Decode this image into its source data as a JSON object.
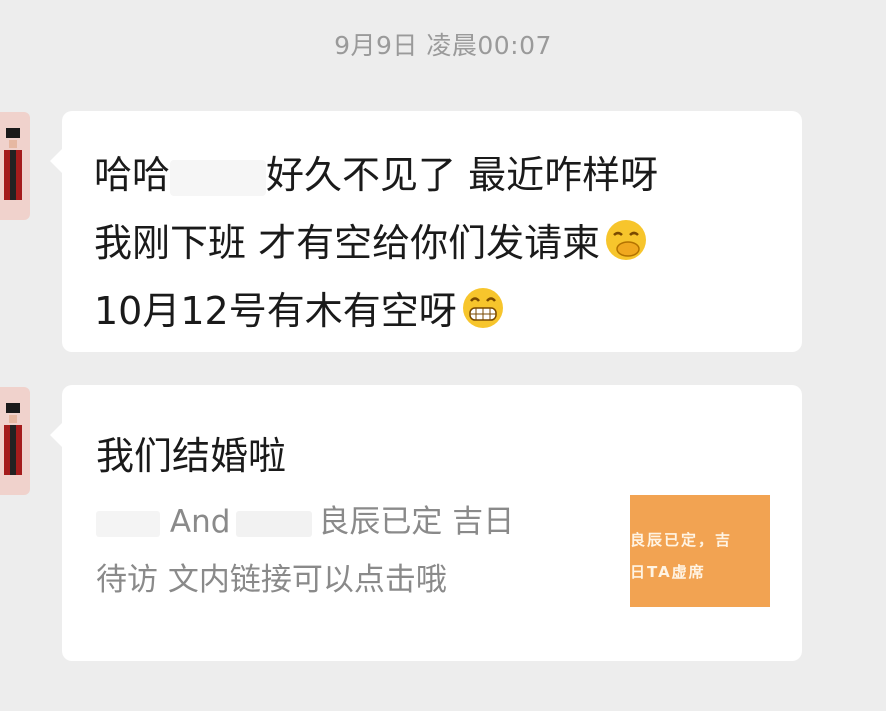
{
  "timestamp": "9月9日 凌晨00:07",
  "messages": [
    {
      "lines": [
        {
          "prefix": "哈哈",
          "suffix": "好久不见了 最近咋样呀"
        },
        {
          "text": "我刚下班  才有空给你们发请柬"
        },
        {
          "text": "10月12号有木有空呀"
        }
      ],
      "emojis": [
        "covering-mouth-laugh-emoji",
        "grin-emoji"
      ]
    },
    {
      "link_card": {
        "title": "我们结婚啦",
        "desc_and": "And",
        "desc_rest": "良辰已定 吉日",
        "desc_line2": "待访  文内链接可以点击哦",
        "thumbnail_line1": "良辰已定，吉",
        "thumbnail_line2": "日TA虚席",
        "thumbnail_color": "#f2a352"
      }
    }
  ]
}
